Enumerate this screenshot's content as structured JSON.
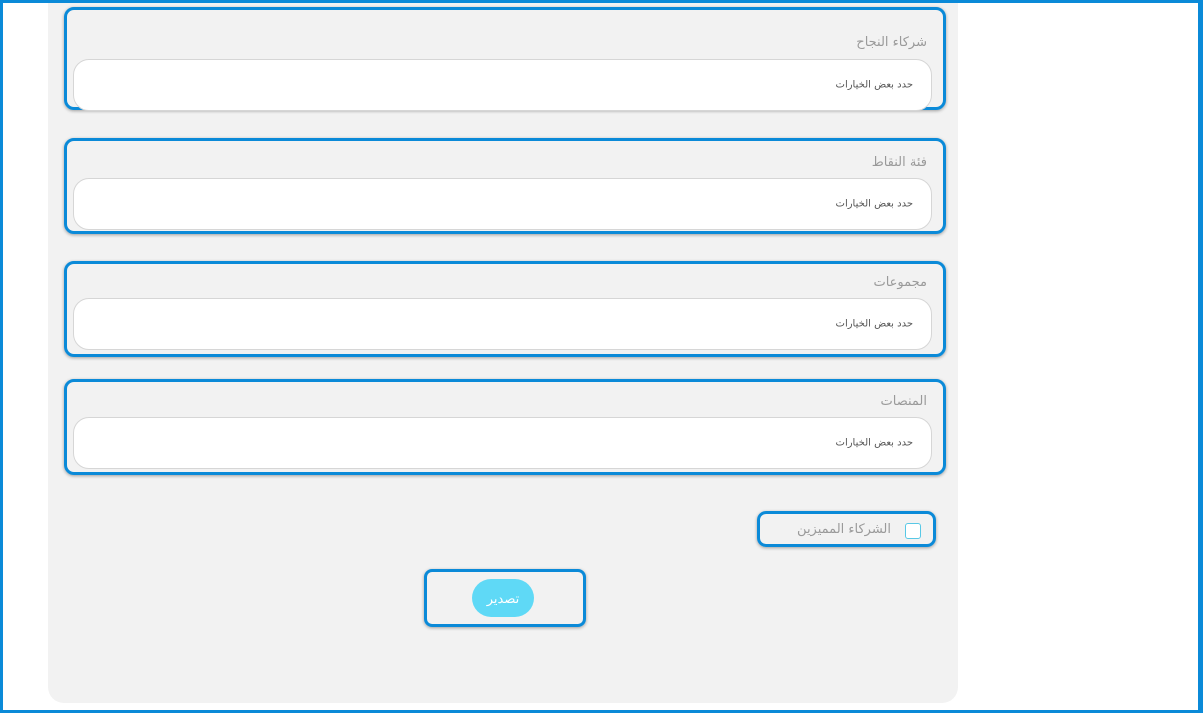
{
  "filters": [
    {
      "label": "شركاء النجاح",
      "placeholder": "حدد بعض الخيارات"
    },
    {
      "label": "فئة النقاط",
      "placeholder": "حدد بعض الخيارات"
    },
    {
      "label": "مجموعات",
      "placeholder": "حدد بعض الخيارات"
    },
    {
      "label": "المنصات",
      "placeholder": "حدد بعض الخيارات"
    }
  ],
  "featured_partners": {
    "label": "الشركاء المميزين",
    "checked": false
  },
  "export_button": {
    "label": "تصدير"
  },
  "colors": {
    "highlight": "#0b8ad8",
    "panel": "#f2f2f2",
    "button": "#5fd9f6"
  }
}
